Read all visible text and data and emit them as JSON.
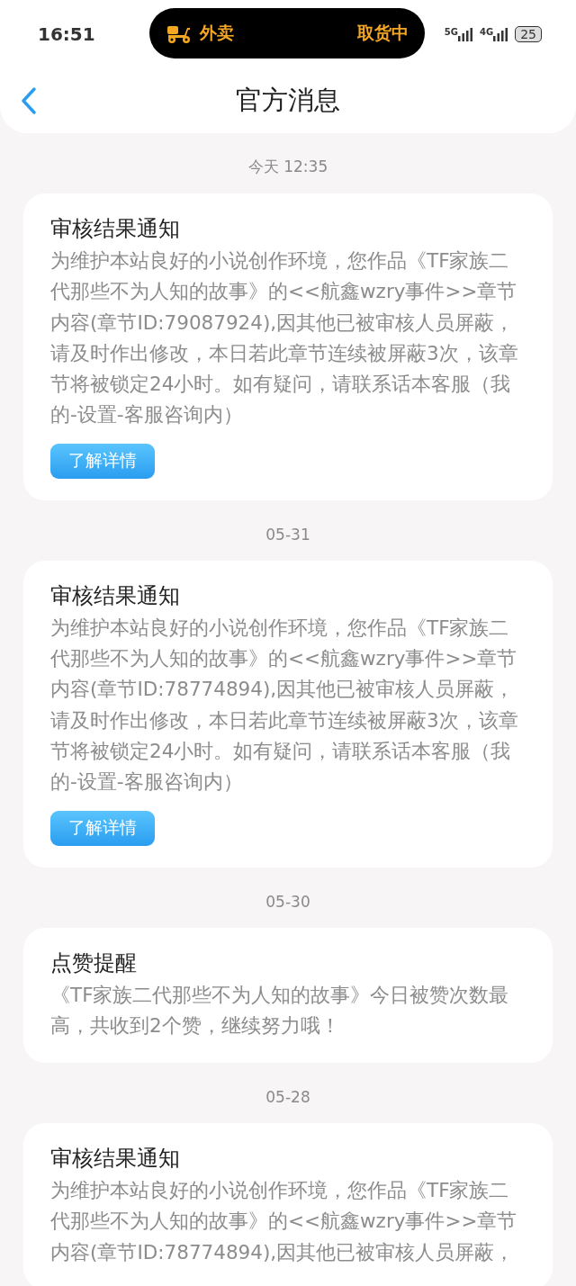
{
  "status_bar": {
    "time": "16:51",
    "island": {
      "app": "外卖",
      "status": "取货中"
    },
    "signals": [
      {
        "label": "5G"
      },
      {
        "label": "4G"
      }
    ],
    "battery": "25"
  },
  "header": {
    "title": "官方消息"
  },
  "messages": [
    {
      "date": "今天 12:35",
      "kind": "review",
      "title": "审核结果通知",
      "body": "为维护本站良好的小说创作环境，您作品《TF家族二代那些不为人知的故事》的<<航鑫wzry事件>>章节内容(章节ID:79087924),因其他已被审核人员屏蔽，请及时作出修改，本日若此章节连续被屏蔽3次，该章节将被锁定24小时。如有疑问，请联系话本客服（我的-设置-客服咨询内）",
      "button": "了解详情"
    },
    {
      "date": "05-31",
      "kind": "review",
      "title": "审核结果通知",
      "body": "为维护本站良好的小说创作环境，您作品《TF家族二代那些不为人知的故事》的<<航鑫wzry事件>>章节内容(章节ID:78774894),因其他已被审核人员屏蔽，请及时作出修改，本日若此章节连续被屏蔽3次，该章节将被锁定24小时。如有疑问，请联系话本客服（我的-设置-客服咨询内）",
      "button": "了解详情"
    },
    {
      "date": "05-30",
      "kind": "like",
      "title": "点赞提醒",
      "body": "《TF家族二代那些不为人知的故事》今日被赞次数最高，共收到2个赞，继续努力哦！"
    },
    {
      "date": "05-28",
      "kind": "review",
      "title": "审核结果通知",
      "body": "为维护本站良好的小说创作环境，您作品《TF家族二代那些不为人知的故事》的<<航鑫wzry事件>>章节内容(章节ID:78774894),因其他已被审核人员屏蔽，"
    }
  ]
}
